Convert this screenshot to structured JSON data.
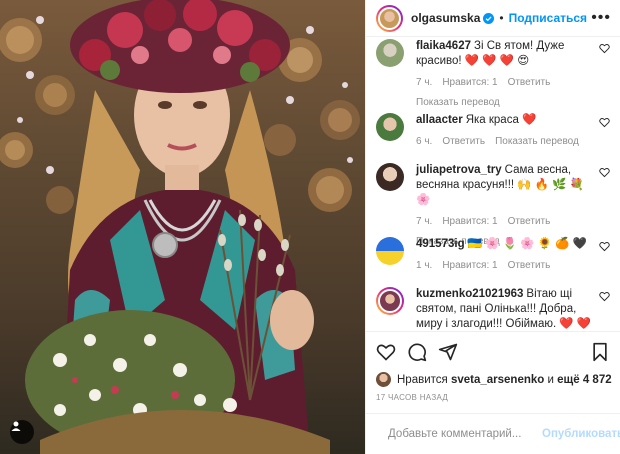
{
  "header": {
    "username": "olgasumska",
    "follow_label": "Подписаться",
    "more_label": "•••",
    "separator": "•"
  },
  "comments": [
    {
      "username": "flaika4627",
      "text": "Зі Св ятом! Дуже красиво! ❤️ ❤️ ❤️ 😍",
      "time": "7 ч.",
      "likes": "Нравится: 1",
      "reply": "Ответить",
      "translate": "Показать перевод"
    },
    {
      "username": "allaacter",
      "text": "Яка краса ❤️",
      "time": "6 ч.",
      "reply": "Ответить",
      "translate": "Показать перевод"
    },
    {
      "username": "juliapetrova_try",
      "text": "Сама весна, весняна красуня!!! 🙌 🔥 🌿 💐 🌸",
      "time": "7 ч.",
      "likes": "Нравится: 1",
      "reply": "Ответить",
      "translate": "Показать перевод"
    },
    {
      "username": "491573ig",
      "text": "🇺🇦 🌸 🌷 🌸 🌻 🍊 🖤",
      "time": "1 ч.",
      "likes": "Нравится: 1",
      "reply": "Ответить"
    },
    {
      "username": "kuzmenko21021963",
      "text": "Вітаю щі святом, пані Олінька!!! Добра, миру і злагоди!!! Обіймаю. ❤️ ❤️"
    }
  ],
  "likes": {
    "prefix": "Нравится",
    "user": "sveta_arsenenko",
    "middle": "и",
    "rest": "ещё 4 872"
  },
  "timestamp": "17 ЧАСОВ НАЗАД",
  "add_comment": {
    "placeholder": "Добавьте комментарий...",
    "post_label": "Опубликовать"
  },
  "colors": {
    "accent": "#0095f6",
    "muted": "#8e8e8e",
    "like_heart": "#ed4956"
  }
}
